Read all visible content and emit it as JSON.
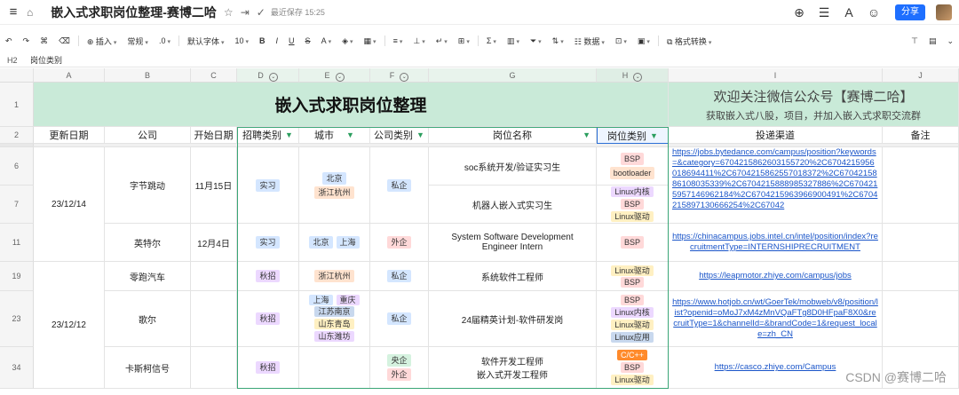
{
  "titlebar": {
    "doc_title": "嵌入式求职岗位整理-赛博二哈",
    "saved": "最近保存 15:25",
    "share": "分享"
  },
  "toolbar": {
    "insert": "插入",
    "format": "常规",
    "decimal": ".0",
    "font": "默认字体",
    "size": "10",
    "data": "数据",
    "convert": "格式转换"
  },
  "formula_bar": {
    "cell_ref": "H2",
    "content": "岗位类别"
  },
  "columns": [
    "A",
    "B",
    "C",
    "D",
    "E",
    "F",
    "G",
    "H",
    "I",
    "J"
  ],
  "rows": [
    "1",
    "2",
    "6",
    "7",
    "11",
    "19",
    "23",
    "34"
  ],
  "sheet": {
    "title": "嵌入式求职岗位整理",
    "promo_line1": "欢迎关注微信公众号【赛博二哈】",
    "promo_line2": "获取嵌入式八股，项目，并加入嵌入式求职交流群",
    "headers": [
      "更新日期",
      "公司",
      "开始日期",
      "招聘类别",
      "城市",
      "公司类别",
      "岗位名称",
      "岗位类别",
      "投递渠道",
      "备注"
    ],
    "records": [
      {
        "date": "23/12/14",
        "company": "字节跳动",
        "start": "11月15日",
        "type": "实习",
        "cities": [
          "北京",
          "浙江杭州"
        ],
        "ctype": "私企",
        "jobs": [
          "soc系统开发/验证实习生",
          "机器人嵌入式实习生"
        ],
        "cats1": [
          "BSP",
          "bootloader"
        ],
        "cats2": [
          "Linux内核",
          "BSP",
          "Linux驱动"
        ],
        "link": "https://jobs.bytedance.com/campus/position?keywords=&category=6704215862603155720%2C6704215956018694411%2C6704215862557018372%2C6704215886108035339%2C6704215888985327886%2C6704215957146962184%2C6704215963966900491%2C6704215897130666254%2C67042"
      },
      {
        "company": "英特尔",
        "start": "12月4日",
        "type": "实习",
        "cities": [
          "北京",
          "上海"
        ],
        "ctype": "外企",
        "job": "System Software Development Engineer Intern",
        "cats": [
          "BSP"
        ],
        "link": "https://chinacampus.jobs.intel.cn/intel/position/index?recruitmentType=INTERNSHIPRECRUITMENT"
      },
      {
        "date": "23/12/12",
        "company": "零跑汽车",
        "type": "秋招",
        "cities": [
          "浙江杭州"
        ],
        "ctype": "私企",
        "job": "系统软件工程师",
        "cats": [
          "Linux驱动",
          "BSP"
        ],
        "link": "https://leapmotor.zhiye.com/campus/jobs"
      },
      {
        "company": "歌尔",
        "type": "秋招",
        "cities": [
          "上海",
          "重庆",
          "江苏南京",
          "山东青岛",
          "山东潍坊"
        ],
        "ctype": "私企",
        "job": "24届精英计划-软件研发岗",
        "cats": [
          "BSP",
          "Linux内核",
          "Linux驱动",
          "Linux应用"
        ],
        "link": "https://www.hotjob.cn/wt/GoerTek/mobweb/v8/position/list?openid=oMoJ7xM4zMnVQaFTg8D0HFpaF8X0&recruitType=1&channelId=&brandCode=1&request_locale=zh_CN"
      },
      {
        "company": "卡斯柯信号",
        "type": "秋招",
        "ctypes": [
          "央企",
          "外企"
        ],
        "jobs": [
          "软件开发工程师",
          "嵌入式开发工程师"
        ],
        "cats": [
          "C/C++",
          "BSP",
          "Linux驱动"
        ],
        "link": "https://casco.zhiye.com/Campus"
      }
    ]
  },
  "watermark": "CSDN @赛博二哈",
  "colors": {
    "header_green": "#c9ead8",
    "accent_blue": "#1e6fff",
    "link": "#1a55c9"
  }
}
